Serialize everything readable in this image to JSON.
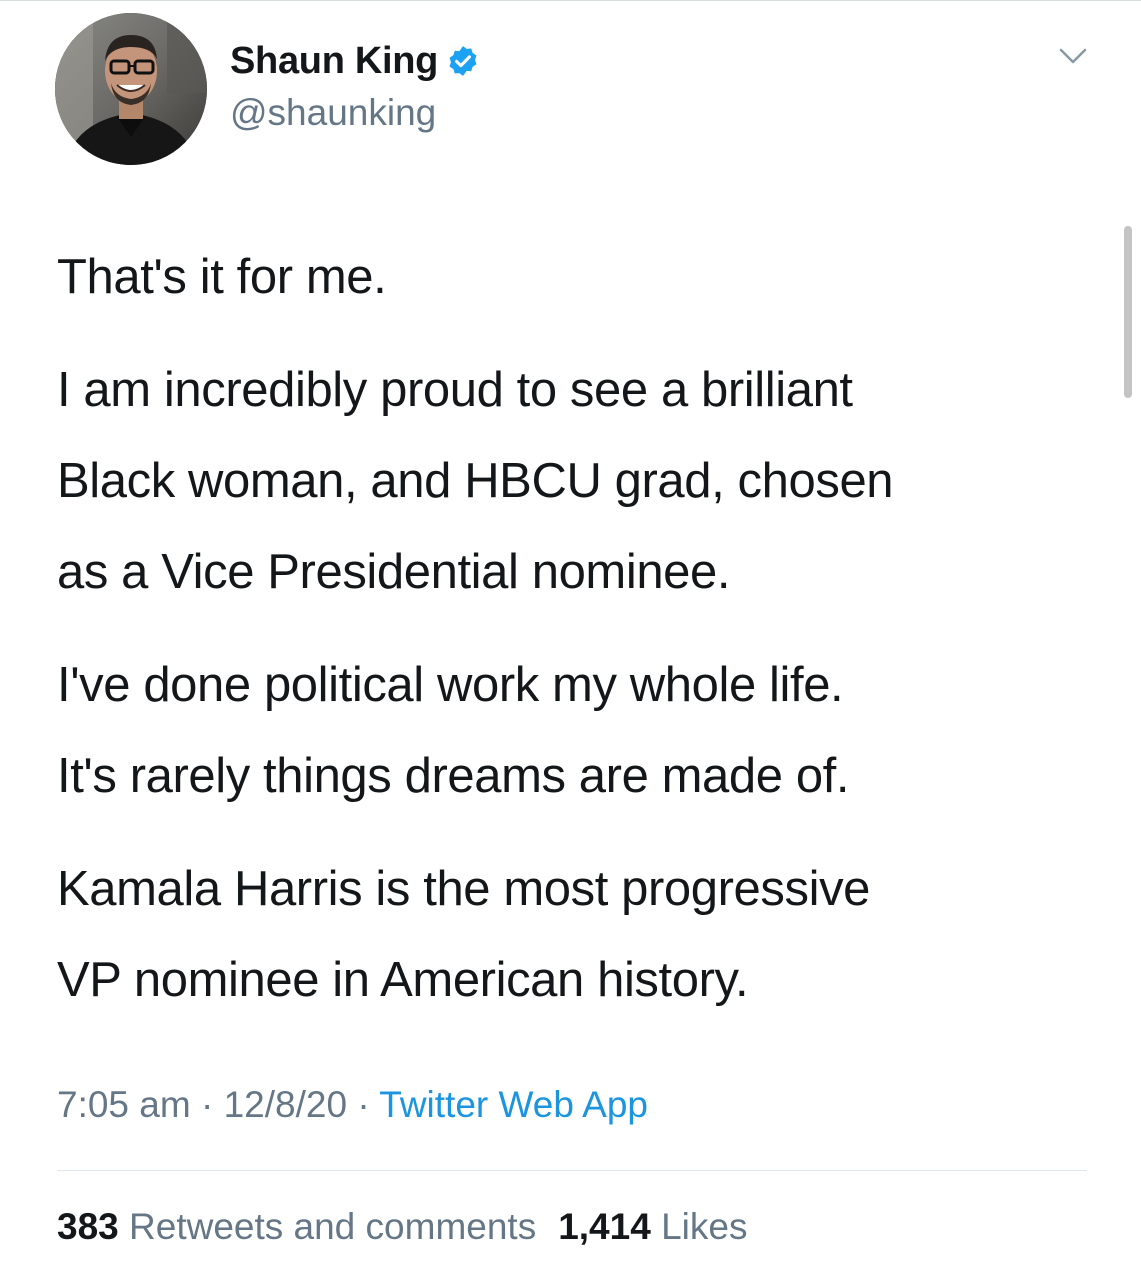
{
  "author": {
    "display_name": "Shaun King",
    "handle": "@shaunking",
    "verified": true
  },
  "tweet": {
    "paragraphs": [
      "That's it for me.",
      "I am incredibly proud to see a brilliant\nBlack woman, and HBCU grad, chosen\nas a Vice Presidential nominee.",
      "I've done political work my whole life.\nIt's rarely things dreams are made of.",
      "Kamala Harris is the most progressive\nVP nominee in American history."
    ]
  },
  "meta": {
    "time": "7:05 am",
    "date": "12/8/20",
    "separator": " · ",
    "source": "Twitter Web App"
  },
  "stats": {
    "retweets_count": "383",
    "retweets_label": "Retweets and comments",
    "likes_count": "1,414",
    "likes_label": "Likes"
  },
  "icons": {
    "verified": "verified-badge-icon",
    "menu": "chevron-down-icon"
  },
  "colors": {
    "accent": "#1b95e0",
    "verified": "#1da1f2",
    "secondary_text": "#657786",
    "primary_text": "#14171a"
  }
}
